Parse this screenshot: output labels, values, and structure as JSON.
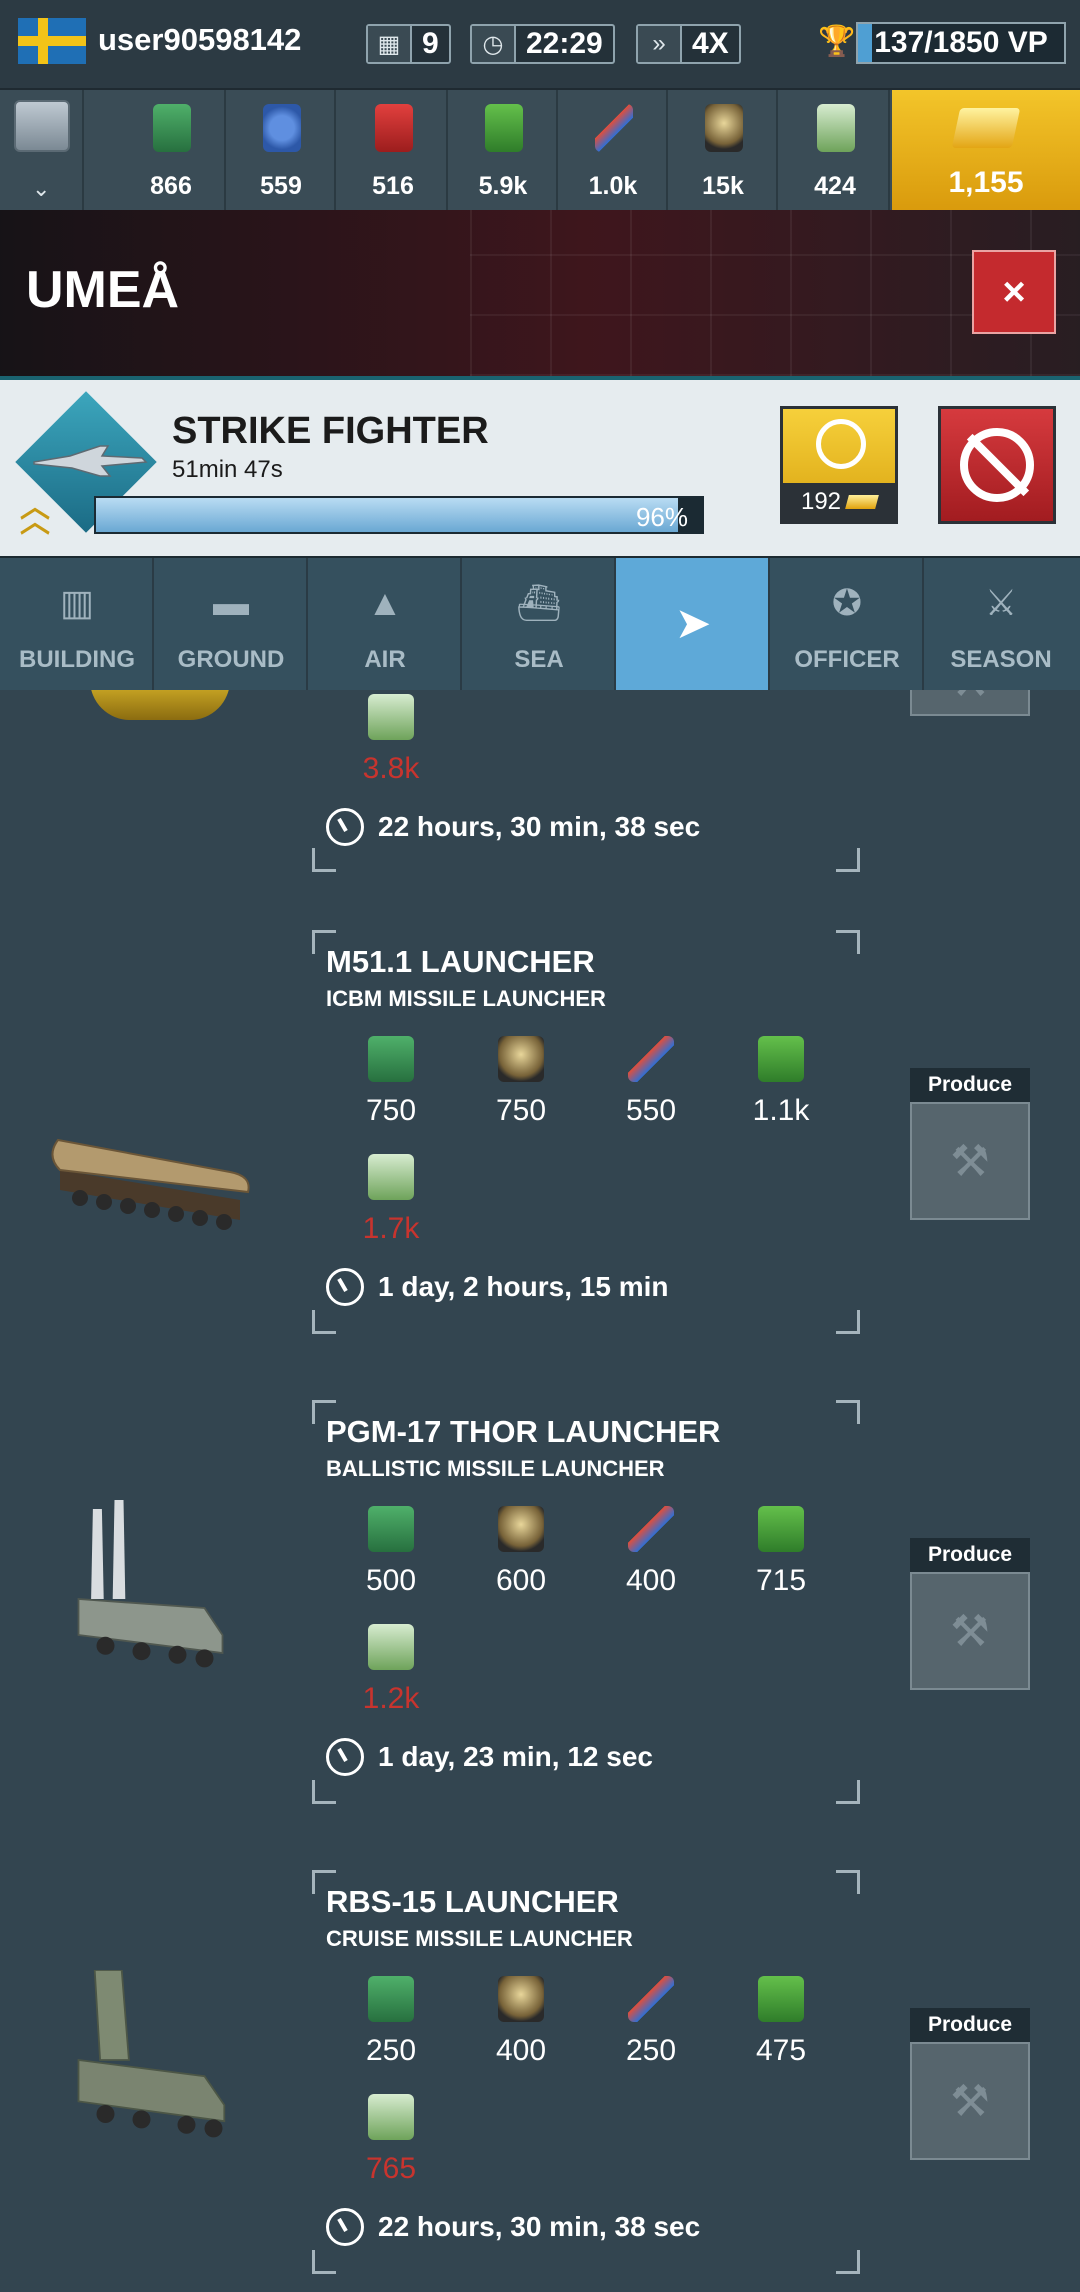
{
  "topbar": {
    "username": "user90598142",
    "days": "9",
    "clock": "22:29",
    "speed": "4X",
    "vp": "137/1850 VP",
    "vp_progress": 0.07
  },
  "resources": [
    {
      "name": "supplies",
      "value": "866",
      "icon": "crate-icon"
    },
    {
      "name": "components",
      "value": "559",
      "icon": "gear-icon"
    },
    {
      "name": "fuel",
      "value": "516",
      "icon": "fuel-can-icon"
    },
    {
      "name": "electronics",
      "value": "5.9k",
      "icon": "chip-icon"
    },
    {
      "name": "rare-materials",
      "value": "1.0k",
      "icon": "missile-icon"
    },
    {
      "name": "manpower",
      "value": "15k",
      "icon": "helmet-icon"
    },
    {
      "name": "money",
      "value": "424",
      "icon": "cash-icon"
    }
  ],
  "gold": {
    "value": "1,155"
  },
  "city": {
    "name": "UMEÅ",
    "close": "×"
  },
  "production": {
    "unit_name": "STRIKE FIGHTER",
    "time_left": "51min 47s",
    "progress_label": "96%",
    "progress": 0.96,
    "speedup_cost": "192"
  },
  "tabs": [
    {
      "label": "BUILDING",
      "icon": "building-icon",
      "glyph": "▥"
    },
    {
      "label": "GROUND",
      "icon": "tank-icon",
      "glyph": "▬"
    },
    {
      "label": "AIR",
      "icon": "jet-icon",
      "glyph": "▲"
    },
    {
      "label": "SEA",
      "icon": "ship-icon",
      "glyph": "⛴"
    },
    {
      "label": "",
      "icon": "missile-tab-icon",
      "glyph": "➤",
      "active": true
    },
    {
      "label": "OFFICER",
      "icon": "officer-badge-icon",
      "glyph": "✪"
    },
    {
      "label": "SEASON",
      "icon": "crossed-swords-icon",
      "glyph": "⚔"
    }
  ],
  "partial_card": {
    "cash_cost": "3.8k",
    "time": "22 hours, 30 min, 38 sec"
  },
  "units": [
    {
      "name": "M51.1 LAUNCHER",
      "type": "ICBM MISSILE LAUNCHER",
      "costs": [
        "750",
        "750",
        "550",
        "1.1k"
      ],
      "cash": "1.7k",
      "time": "1 day, 2 hours, 15 min",
      "produce_label": "Produce"
    },
    {
      "name": "PGM-17 THOR LAUNCHER",
      "type": "BALLISTIC MISSILE LAUNCHER",
      "costs": [
        "500",
        "600",
        "400",
        "715"
      ],
      "cash": "1.2k",
      "time": "1 day, 23 min, 12 sec",
      "produce_label": "Produce"
    },
    {
      "name": "RBS-15 LAUNCHER",
      "type": "CRUISE MISSILE LAUNCHER",
      "costs": [
        "250",
        "400",
        "250",
        "475"
      ],
      "cash": "765",
      "time": "22 hours, 30 min, 38 sec",
      "produce_label": "Produce"
    }
  ],
  "colors": {
    "accent_blue": "#5ea9d8",
    "gold": "#f3c52a",
    "cancel_red": "#c42a2e",
    "insufficient_red": "#c8342e"
  }
}
